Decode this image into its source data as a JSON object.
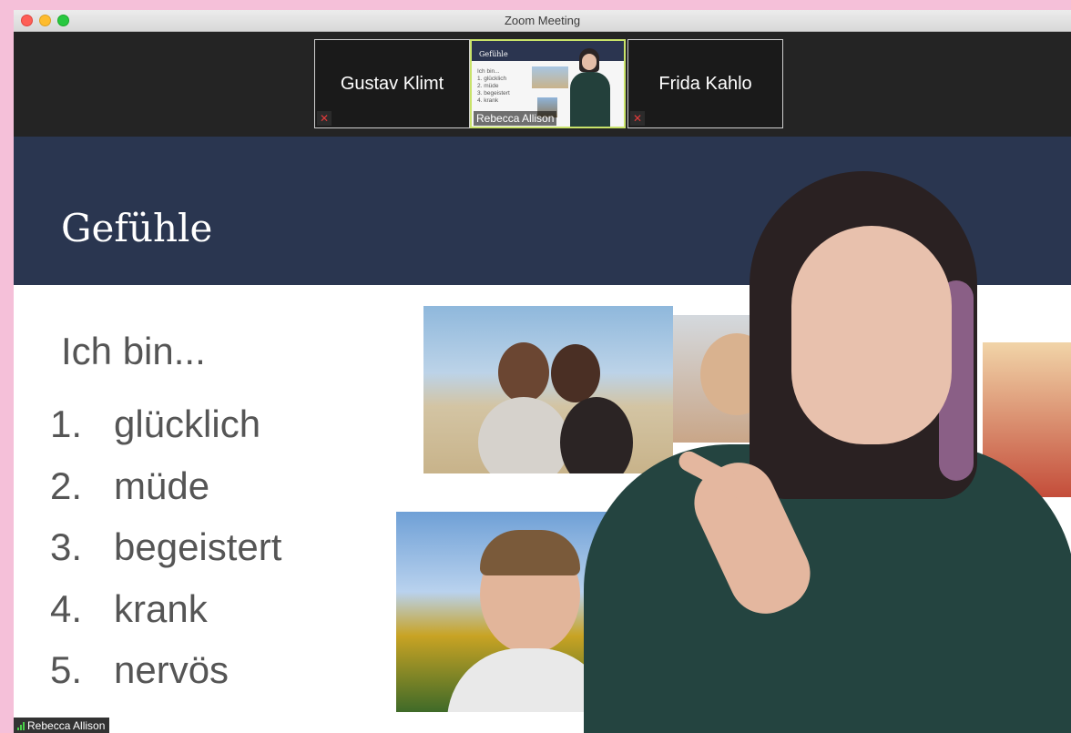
{
  "window": {
    "title": "Zoom Meeting"
  },
  "participants": [
    {
      "name": "Gustav Klimt",
      "muted": true
    },
    {
      "name": "Rebecca Allison",
      "muted": false,
      "active_speaker": true
    },
    {
      "name": "Frida Kahlo",
      "muted": true
    }
  ],
  "thumbnail_slide": {
    "title": "Gefühle",
    "intro": "Ich bin...",
    "items": [
      "1.  glücklich",
      "2.  müde",
      "3.  begeistert",
      "4.  krank"
    ]
  },
  "slide": {
    "title": "Gefühle",
    "intro": "Ich bin...",
    "items": [
      {
        "num": "1.",
        "word": "glücklich"
      },
      {
        "num": "2.",
        "word": "müde"
      },
      {
        "num": "3.",
        "word": "begeistert"
      },
      {
        "num": "4.",
        "word": "krank"
      },
      {
        "num": "5.",
        "word": "nervös"
      }
    ]
  },
  "video_label": {
    "name": "Rebecca Allison"
  },
  "icons": {
    "mute": "mic-muted-icon",
    "signal": "signal-strength-icon"
  },
  "colors": {
    "slide_header": "#2a3650",
    "active_border": "#c9e36a",
    "mute_red": "#e23a3a",
    "background": "#f5c0d9"
  }
}
